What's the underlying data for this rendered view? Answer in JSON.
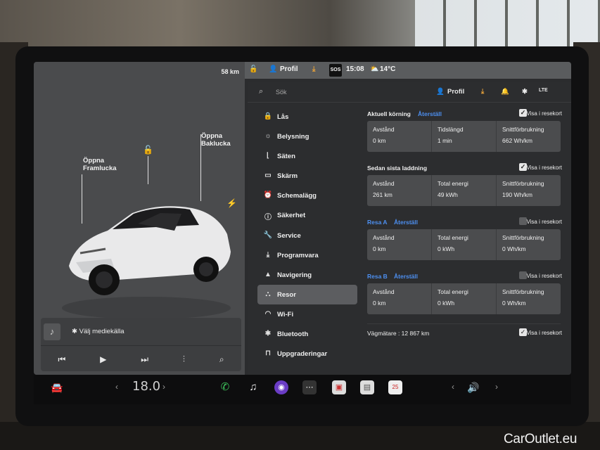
{
  "car": {
    "range": "58 km",
    "front_trunk_label": "Öppna\nFramlucka",
    "rear_trunk_label": "Öppna\nBaklucka"
  },
  "media": {
    "source_label": "Välj mediekälla"
  },
  "status_bar": {
    "profile": "Profil",
    "sos": "SOS",
    "time": "15:08",
    "temperature": "14°C"
  },
  "settings_header": {
    "search_placeholder": "Sök",
    "profile": "Profil",
    "signal": "LTE"
  },
  "nav": {
    "items": [
      {
        "label": "Lås",
        "icon": "lock-icon"
      },
      {
        "label": "Belysning",
        "icon": "sun-icon"
      },
      {
        "label": "Säten",
        "icon": "seat-icon"
      },
      {
        "label": "Skärm",
        "icon": "display-icon"
      },
      {
        "label": "Schemalägg",
        "icon": "clock-icon"
      },
      {
        "label": "Säkerhet",
        "icon": "info-icon"
      },
      {
        "label": "Service",
        "icon": "wrench-icon"
      },
      {
        "label": "Programvara",
        "icon": "download-icon"
      },
      {
        "label": "Navigering",
        "icon": "navigation-icon"
      },
      {
        "label": "Resor",
        "icon": "trips-icon",
        "active": true
      },
      {
        "label": "Wi-Fi",
        "icon": "wifi-icon"
      },
      {
        "label": "Bluetooth",
        "icon": "bluetooth-icon"
      },
      {
        "label": "Uppgraderingar",
        "icon": "bag-icon"
      }
    ]
  },
  "trips": {
    "show_in_card_label": "Visa i resekort",
    "reset_label": "Återställ",
    "current": {
      "title": "Aktuell körning",
      "checked": true,
      "cells": [
        {
          "label": "Avstånd",
          "value": "0 km"
        },
        {
          "label": "Tidslängd",
          "value": "1 min"
        },
        {
          "label": "Snittförbrukning",
          "value": "662 Wh/km"
        }
      ]
    },
    "since_charge": {
      "title": "Sedan sista laddning",
      "checked": true,
      "cells": [
        {
          "label": "Avstånd",
          "value": "261 km"
        },
        {
          "label": "Total energi",
          "value": "49 kWh"
        },
        {
          "label": "Snittförbrukning",
          "value": "190 Wh/km"
        }
      ]
    },
    "trip_a": {
      "title": "Resa A",
      "checked": false,
      "cells": [
        {
          "label": "Avstånd",
          "value": "0 km"
        },
        {
          "label": "Total energi",
          "value": "0 kWh"
        },
        {
          "label": "Snittförbrukning",
          "value": "0 Wh/km"
        }
      ]
    },
    "trip_b": {
      "title": "Resa B",
      "checked": false,
      "cells": [
        {
          "label": "Avstånd",
          "value": "0 km"
        },
        {
          "label": "Total energi",
          "value": "0 kWh"
        },
        {
          "label": "Snittförbrukning",
          "value": "0 Wh/km"
        }
      ]
    },
    "odometer": "Vägmätare : 12 867 km",
    "odometer_checked": true
  },
  "taskbar": {
    "cabin_temp": "18.0"
  },
  "watermark": "CarOutlet.eu",
  "colors": {
    "accent_blue": "#4d8ff0",
    "download_orange": "#e8a23a",
    "phone_green": "#3ec45c"
  }
}
